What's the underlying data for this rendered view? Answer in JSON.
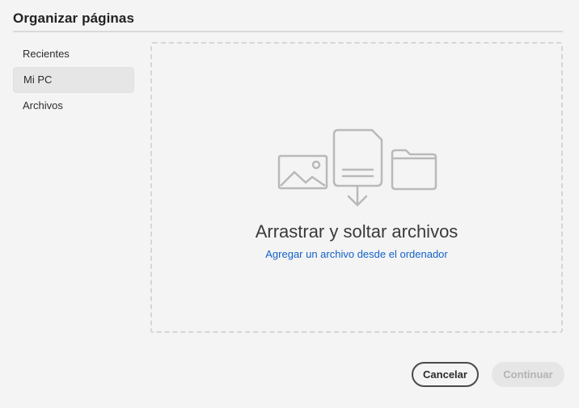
{
  "dialog": {
    "title": "Organizar páginas"
  },
  "sidebar": {
    "items": [
      {
        "label": "Recientes",
        "selected": false
      },
      {
        "label": "Mi PC",
        "selected": true
      },
      {
        "label": "Archivos",
        "selected": false
      }
    ]
  },
  "dropzone": {
    "title": "Arrastrar y soltar archivos",
    "link": "Agregar un archivo desde el ordenador",
    "icons": [
      "image-icon",
      "document-download-icon",
      "folder-icon"
    ]
  },
  "footer": {
    "cancel_label": "Cancelar",
    "continue_label": "Continuar",
    "continue_enabled": false
  },
  "colors": {
    "background": "#f4f4f4",
    "link": "#1262c9",
    "disabled_button_bg": "#e6e6e6",
    "disabled_button_text": "#b3b3b3",
    "icon_stroke": "#b9b9b9"
  }
}
